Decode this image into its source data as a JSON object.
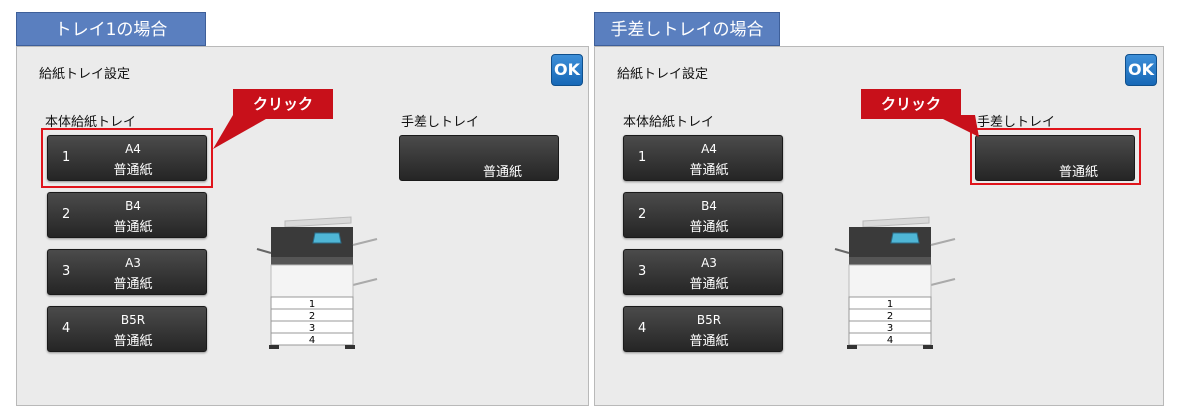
{
  "left": {
    "header": "トレイ1の場合",
    "panel_title": "給紙トレイ設定",
    "ok_label": "OK",
    "main_tray_label": "本体給紙トレイ",
    "manual_tray_label": "手差しトレイ",
    "callout": "クリック",
    "trays": [
      {
        "num": "1",
        "size": "A4",
        "media": "普通紙"
      },
      {
        "num": "2",
        "size": "B4",
        "media": "普通紙"
      },
      {
        "num": "3",
        "size": "A3",
        "media": "普通紙"
      },
      {
        "num": "4",
        "size": "B5R",
        "media": "普通紙"
      }
    ],
    "manual_media": "普通紙",
    "highlight": "tray-1"
  },
  "right": {
    "header": "手差しトレイの場合",
    "panel_title": "給紙トレイ設定",
    "ok_label": "OK",
    "main_tray_label": "本体給紙トレイ",
    "manual_tray_label": "手差しトレイ",
    "callout": "クリック",
    "trays": [
      {
        "num": "1",
        "size": "A4",
        "media": "普通紙"
      },
      {
        "num": "2",
        "size": "B4",
        "media": "普通紙"
      },
      {
        "num": "3",
        "size": "A3",
        "media": "普通紙"
      },
      {
        "num": "4",
        "size": "B5R",
        "media": "普通紙"
      }
    ],
    "manual_media": "普通紙",
    "highlight": "manual-tray"
  },
  "printer_tray_numbers": [
    "1",
    "2",
    "3",
    "4"
  ],
  "colors": {
    "header_bg": "#5a7fbf",
    "panel_bg": "#ebebeb",
    "button_dark": "#2f2f2f",
    "ok_blue": "#1f78c8",
    "highlight_red": "#e0141b",
    "callout_red": "#c8101a",
    "printer_screen": "#4fb6d6"
  }
}
